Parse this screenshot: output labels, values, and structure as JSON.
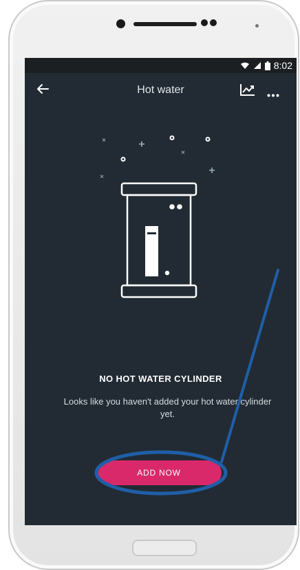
{
  "background": {
    "partial_text": "t"
  },
  "status_bar": {
    "time": "8:02"
  },
  "app_bar": {
    "title": "Hot water",
    "back_icon": "arrow-left-icon",
    "chart_icon": "line-chart-icon",
    "more_icon": "ellipsis-icon"
  },
  "empty_state": {
    "title": "NO HOT WATER CYLINDER",
    "description": "Looks like you haven't added your hot water cylinder yet.",
    "button_label": "ADD NOW"
  },
  "colors": {
    "screen_bg": "#222b33",
    "accent": "#d9296a",
    "annotation": "#1f5fa8"
  }
}
